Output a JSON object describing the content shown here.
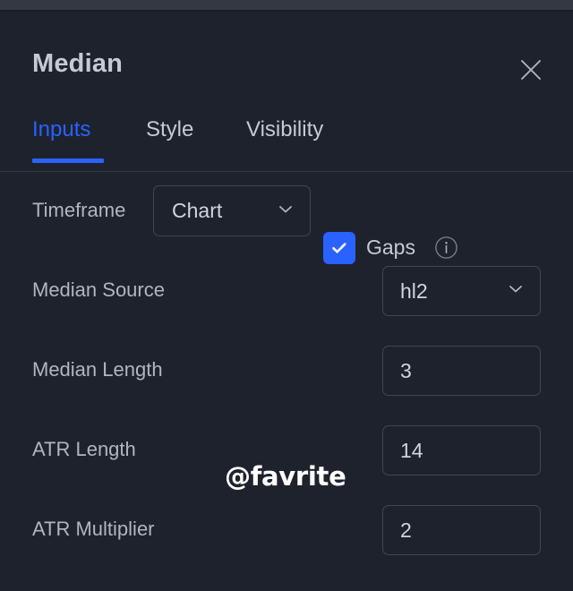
{
  "dialog": {
    "title": "Median",
    "close_label": "Close",
    "close_icon": "close-icon"
  },
  "tabs": {
    "items": [
      {
        "label": "Inputs",
        "active": true
      },
      {
        "label": "Style",
        "active": false
      },
      {
        "label": "Visibility",
        "active": false
      }
    ],
    "active_index": 0
  },
  "colors": {
    "accent": "#2962ff",
    "panel_bg": "#1e222d",
    "top_strip": "#333841",
    "border": "#434651",
    "label_text": "#b2b5be",
    "value_text": "#d1d4dc",
    "title_text": "#c5cad3",
    "separator": "#363a45"
  },
  "inputs": {
    "timeframe": {
      "label": "Timeframe",
      "value": "Chart",
      "chevron_icon": "chevron-down-icon",
      "gaps": {
        "label": "Gaps",
        "checked": true,
        "checkbox_icon": "check-icon",
        "info_icon": "info-icon"
      }
    },
    "median_source": {
      "label": "Median Source",
      "value": "hl2",
      "chevron_icon": "chevron-down-icon"
    },
    "median_length": {
      "label": "Median Length",
      "value": "3"
    },
    "atr_length": {
      "label": "ATR Length",
      "value": "14"
    },
    "atr_multiplier": {
      "label": "ATR Multiplier",
      "value": "2"
    }
  },
  "watermark": {
    "text": "@favrite"
  }
}
